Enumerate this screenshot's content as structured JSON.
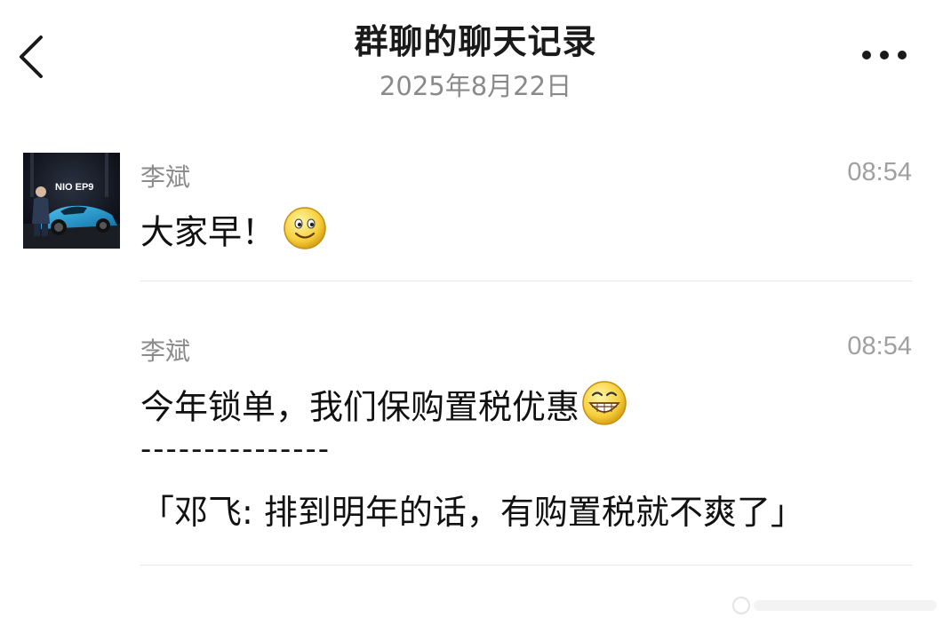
{
  "header": {
    "back_icon": "chevron-left-icon",
    "title": "群聊的聊天记录",
    "date": "2025年8月22日",
    "more_icon": "more-horizontal-icon"
  },
  "messages": [
    {
      "sender": "李斌",
      "time": "08:54",
      "text": "大家早！",
      "emoji": "smile-emoji"
    },
    {
      "sender": "李斌",
      "time": "08:54",
      "text": "今年锁单，我们保购置税优惠",
      "emoji": "grin-emoji",
      "separator": "---------------",
      "quote": "「邓飞: 排到明年的话，有购置税就不爽了」"
    }
  ],
  "avatar": {
    "icon": "user-avatar-car",
    "logo_text": "NIO EP9"
  },
  "colors": {
    "text": "#111111",
    "muted": "#8c8c8c",
    "divider": "#e6e6e6",
    "avatar_bg": "#0f1420",
    "car": "#1e9fd8"
  }
}
